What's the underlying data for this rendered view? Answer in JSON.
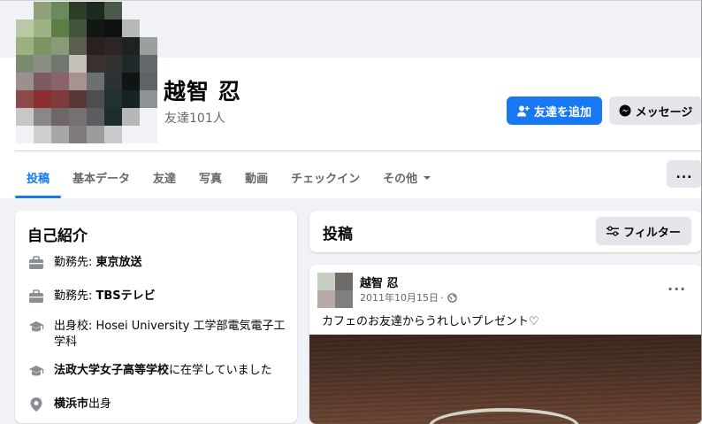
{
  "profile": {
    "name": "越智 忍",
    "friends_count": "友達101人"
  },
  "actions": {
    "add_friend_label": "友達を追加",
    "message_label": "メッセージ",
    "more_label": "..."
  },
  "tabs": [
    {
      "label": "投稿",
      "active": true
    },
    {
      "label": "基本データ",
      "active": false
    },
    {
      "label": "友達",
      "active": false
    },
    {
      "label": "写真",
      "active": false
    },
    {
      "label": "動画",
      "active": false
    },
    {
      "label": "チェックイン",
      "active": false
    },
    {
      "label": "その他",
      "active": false
    }
  ],
  "intro": {
    "title": "自己紹介",
    "items": [
      {
        "icon": "briefcase-icon",
        "prefix": "勤務先: ",
        "bold": "東京放送",
        "suffix": ""
      },
      {
        "icon": "briefcase-icon",
        "prefix": "勤務先: ",
        "bold": "TBSテレビ",
        "suffix": ""
      },
      {
        "icon": "graduation-cap-icon",
        "prefix": "出身校: ",
        "bold": "",
        "suffix": "Hosei University 工学部電気電子工学科"
      },
      {
        "icon": "graduation-cap-icon",
        "prefix": "",
        "bold": "法政大学女子高等学校",
        "suffix": "に在学していました"
      },
      {
        "icon": "location-pin-icon",
        "prefix": "",
        "bold": "横浜市",
        "suffix": "出身"
      }
    ]
  },
  "posts": {
    "title": "投稿",
    "filter_label": "フィルター"
  },
  "post": {
    "author": "越智 忍",
    "date": "2011年10月15日",
    "separator": "·",
    "text": "カフェのお友達からうれしいプレゼント♡",
    "more": "..."
  },
  "colors": {
    "accent": "#1877f2",
    "background": "#f0f2f5",
    "secondary_button": "#e4e6eb",
    "muted_text": "#65676b"
  }
}
